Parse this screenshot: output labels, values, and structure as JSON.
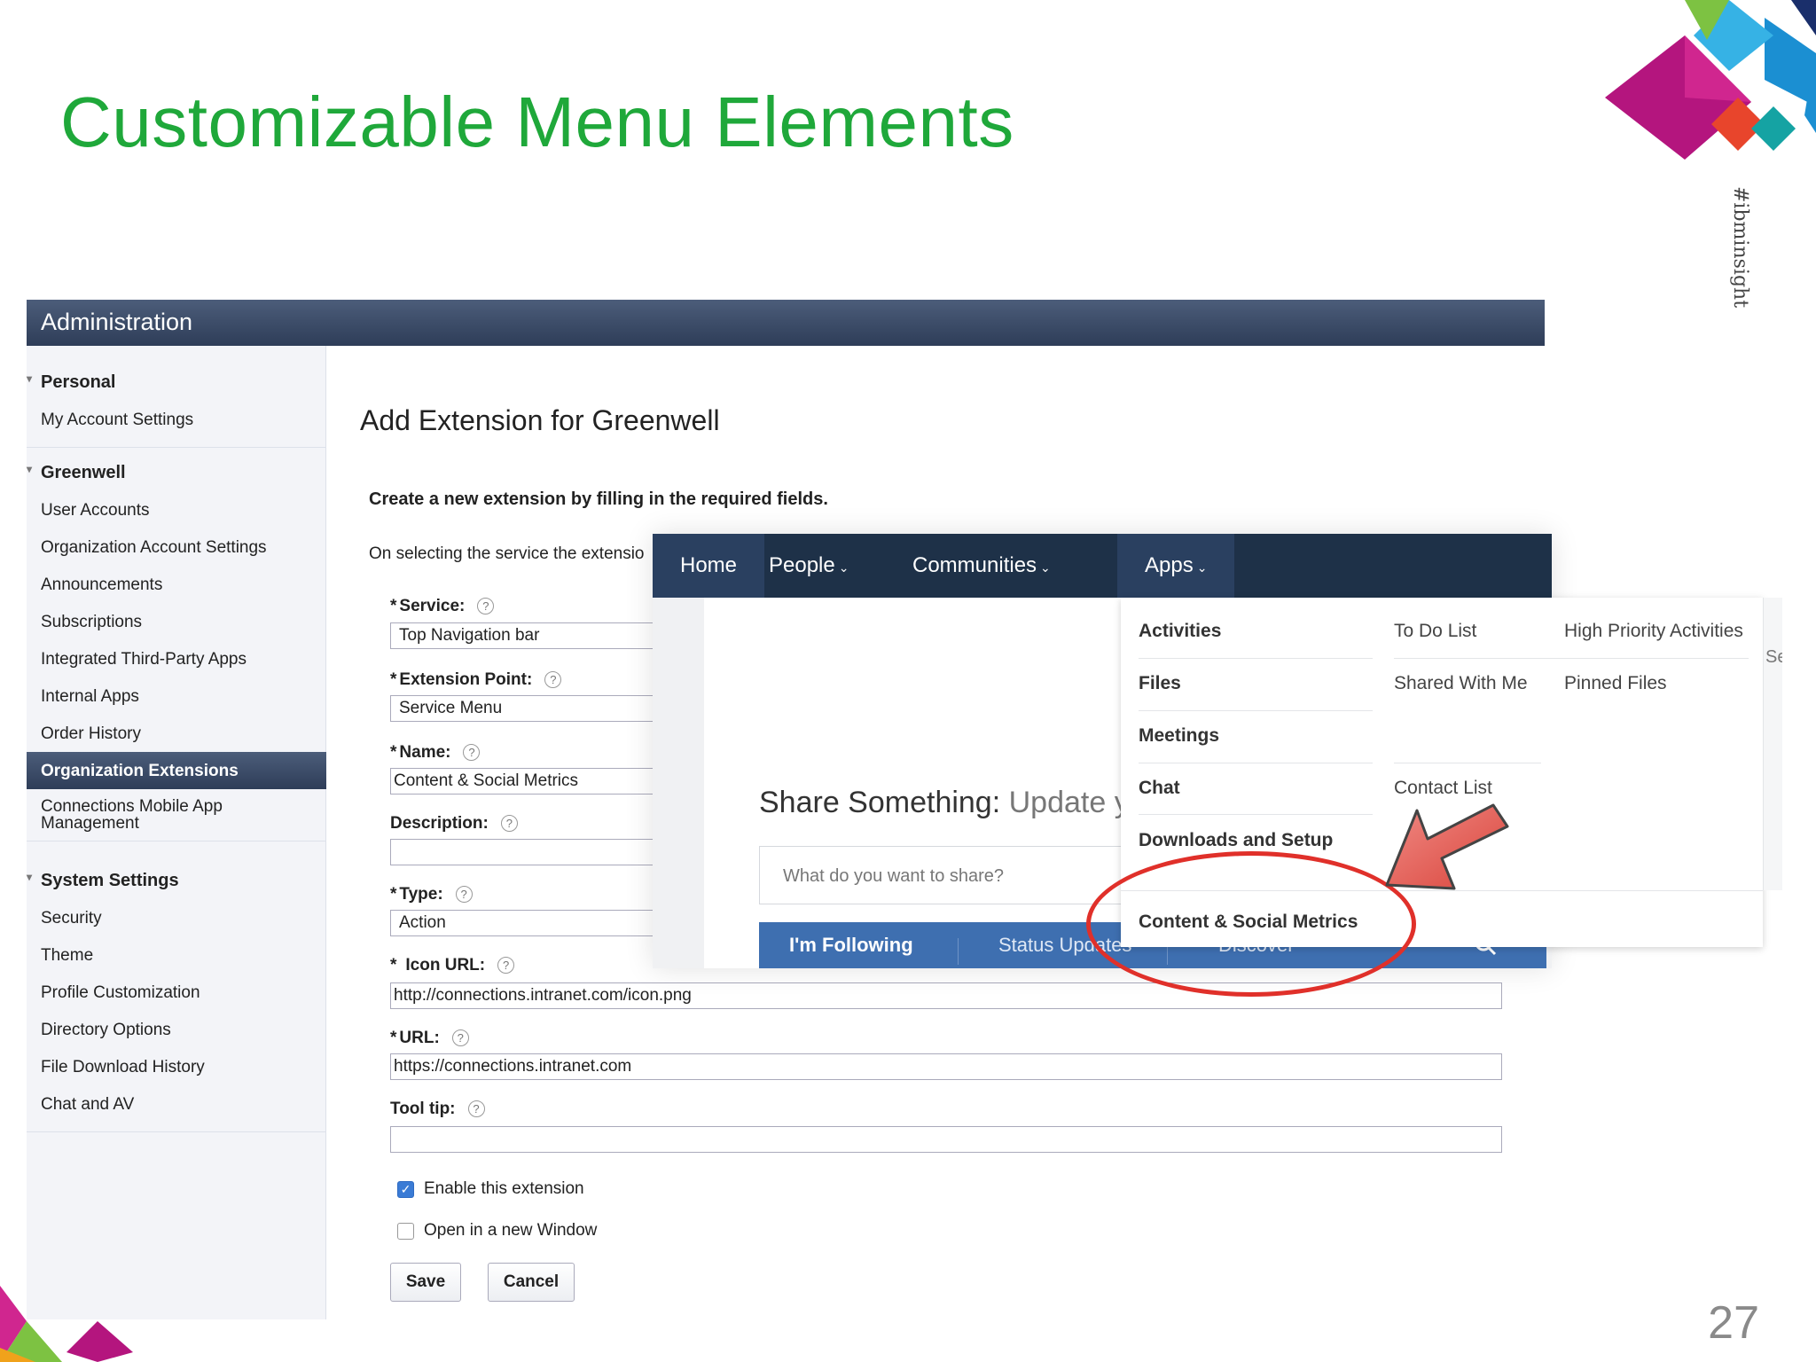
{
  "slide": {
    "title": "Customizable Menu Elements",
    "hashtag": "#ibminsight",
    "page_number": "27"
  },
  "admin": {
    "header": "Administration",
    "sidebar": {
      "personal": {
        "label": "Personal",
        "items": [
          "My Account Settings"
        ]
      },
      "greenwell": {
        "label": "Greenwell",
        "items": [
          "User Accounts",
          "Organization Account Settings",
          "Announcements",
          "Subscriptions",
          "Integrated Third-Party Apps",
          "Internal Apps",
          "Order History",
          "Organization Extensions",
          "Connections Mobile App Management"
        ],
        "active_item": "Organization Extensions"
      },
      "system": {
        "label": "System Settings",
        "items": [
          "Security",
          "Theme",
          "Profile Customization",
          "Directory Options",
          "File Download History",
          "Chat and AV"
        ]
      }
    },
    "form": {
      "title": "Add Extension for Greenwell",
      "intro": "Create a new extension by filling in the required fields.",
      "note": "On selecting the service the extensio",
      "fields": {
        "service": {
          "label": "Service:",
          "required": "*",
          "value": "Top Navigation bar"
        },
        "extension_point": {
          "label": "Extension Point:",
          "required": "*",
          "value": "Service Menu"
        },
        "name": {
          "label": "Name:",
          "required": "*",
          "value": "Content & Social Metrics"
        },
        "description": {
          "label": "Description:",
          "value": ""
        },
        "type": {
          "label": "Type:",
          "required": "*",
          "value": "Action"
        },
        "icon_url": {
          "label": "Icon URL:",
          "required": "*",
          "value": "http://connections.intranet.com/icon.png"
        },
        "url": {
          "label": "URL:",
          "required": "*",
          "value": "https://connections.intranet.com"
        },
        "tool_tip": {
          "label": "Tool tip:",
          "value": ""
        }
      },
      "help_glyph": "?",
      "checkboxes": {
        "enable": {
          "label": "Enable this extension",
          "checked": true,
          "mark": "✓"
        },
        "new_window": {
          "label": "Open in a new Window",
          "checked": false
        }
      },
      "buttons": {
        "save": "Save",
        "cancel": "Cancel"
      }
    }
  },
  "connections": {
    "nav": {
      "home": "Home",
      "people": "People",
      "communities": "Communities",
      "apps": "Apps",
      "chevron": "⌄"
    },
    "share": {
      "title": "Share Something:",
      "title_light": "Update y",
      "placeholder": "What do you want to share?"
    },
    "tabs": {
      "following": "I'm Following",
      "status": "Status Updates",
      "discover": "Discover"
    },
    "apps_menu": {
      "activities": "Activities",
      "todo": "To Do List",
      "high_priority": "High Priority Activities",
      "files": "Files",
      "shared_with_me": "Shared With Me",
      "pinned_files": "Pinned Files",
      "meetings": "Meetings",
      "chat": "Chat",
      "contact_list": "Contact List",
      "downloads": "Downloads and Setup",
      "content_metrics": "Content & Social Metrics",
      "strip_text": "Se"
    }
  },
  "colors": {
    "title_green": "#1fa83a",
    "admin_header": "#2e3d58",
    "nav_bar": "#1e3148",
    "tabs_blue": "#3e6fb0",
    "highlight_red": "#e0302a"
  }
}
